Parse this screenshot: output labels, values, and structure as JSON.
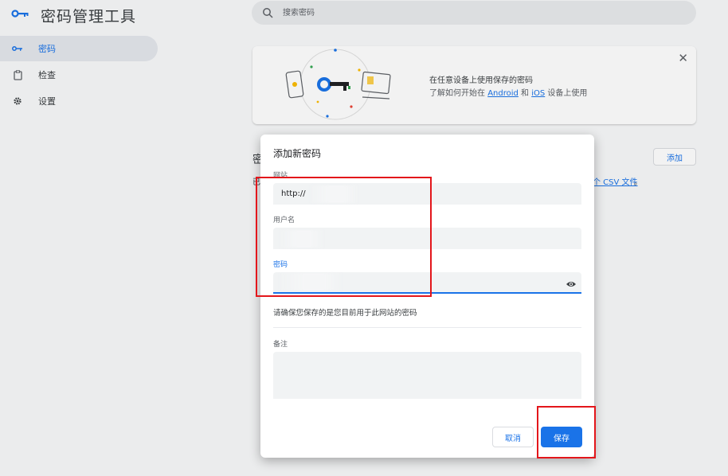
{
  "app": {
    "title": "密码管理工具"
  },
  "search": {
    "placeholder": "搜索密码"
  },
  "sidebar": {
    "items": [
      {
        "label": "密码",
        "icon": "key-icon",
        "active": true
      },
      {
        "label": "检查",
        "icon": "checkup-icon",
        "active": false
      },
      {
        "label": "设置",
        "icon": "gear-icon",
        "active": false
      }
    ]
  },
  "promo": {
    "title": "在任意设备上使用保存的密码",
    "desc_prefix": "了解如何开始在",
    "link_android": "Android",
    "desc_and": "和",
    "link_ios": "iOS",
    "desc_suffix": "设备上使用"
  },
  "background_section": {
    "title_char": "密",
    "sub_char": "已",
    "add_label": "添加",
    "csv_link": "个 CSV 文件",
    "csv_tail": "。"
  },
  "dialog": {
    "title": "添加新密码",
    "site_label": "网站",
    "site_value": "http://",
    "username_label": "用户名",
    "username_value": "",
    "password_label": "密码",
    "password_value": "",
    "hint": "请确保您保存的是您目前用于此网站的密码",
    "note_label": "备注",
    "note_value": "",
    "cancel_label": "取消",
    "save_label": "保存"
  },
  "colors": {
    "accent": "#1a73e8",
    "highlight": "#e3161b",
    "field_bg": "#f1f3f4"
  }
}
